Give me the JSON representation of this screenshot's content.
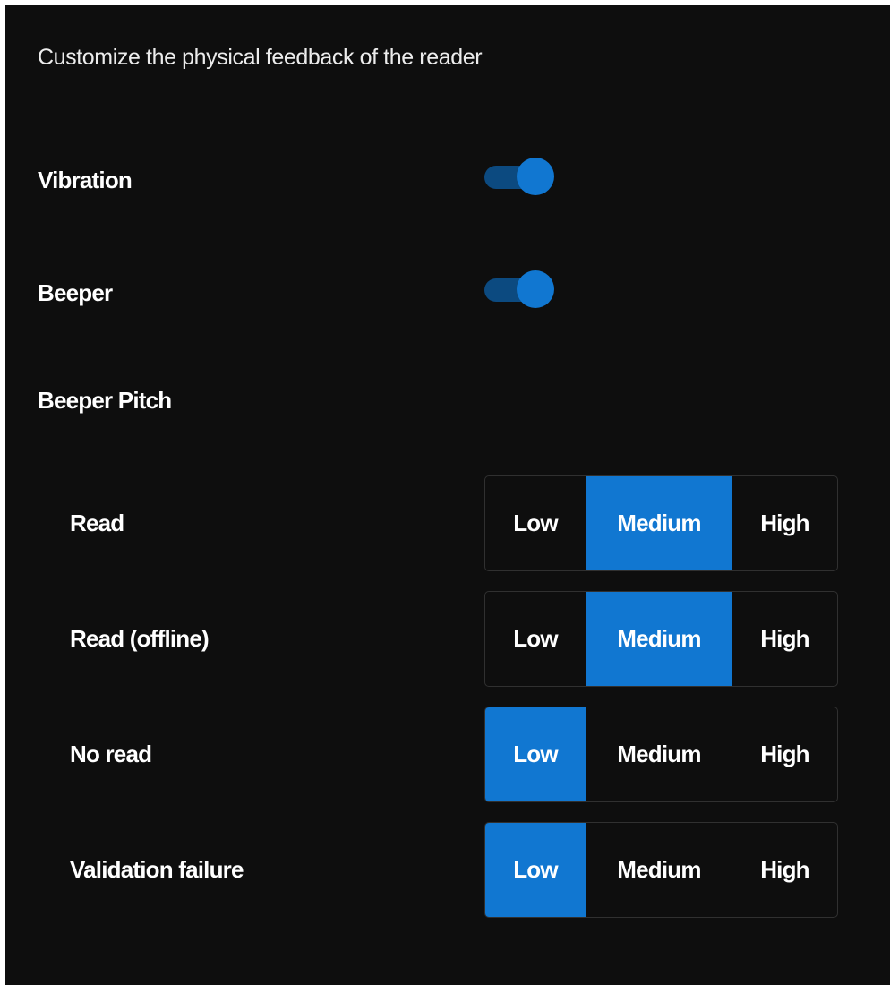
{
  "header": {
    "subtitle": "Customize the physical feedback of the reader"
  },
  "colors": {
    "background": "#0e0e0e",
    "accent": "#1177d1",
    "toggle_track_on": "#0c4a80",
    "segment_border": "#303030",
    "text": "#ffffff"
  },
  "settings": {
    "vibration": {
      "label": "Vibration",
      "enabled": true
    },
    "beeper": {
      "label": "Beeper",
      "enabled": true
    }
  },
  "beeper_pitch": {
    "heading": "Beeper Pitch",
    "options": [
      "Low",
      "Medium",
      "High"
    ],
    "rows": [
      {
        "label": "Read",
        "selected": "Medium"
      },
      {
        "label": "Read (offline)",
        "selected": "Medium"
      },
      {
        "label": "No read",
        "selected": "Low"
      },
      {
        "label": "Validation failure",
        "selected": "Low"
      }
    ]
  }
}
